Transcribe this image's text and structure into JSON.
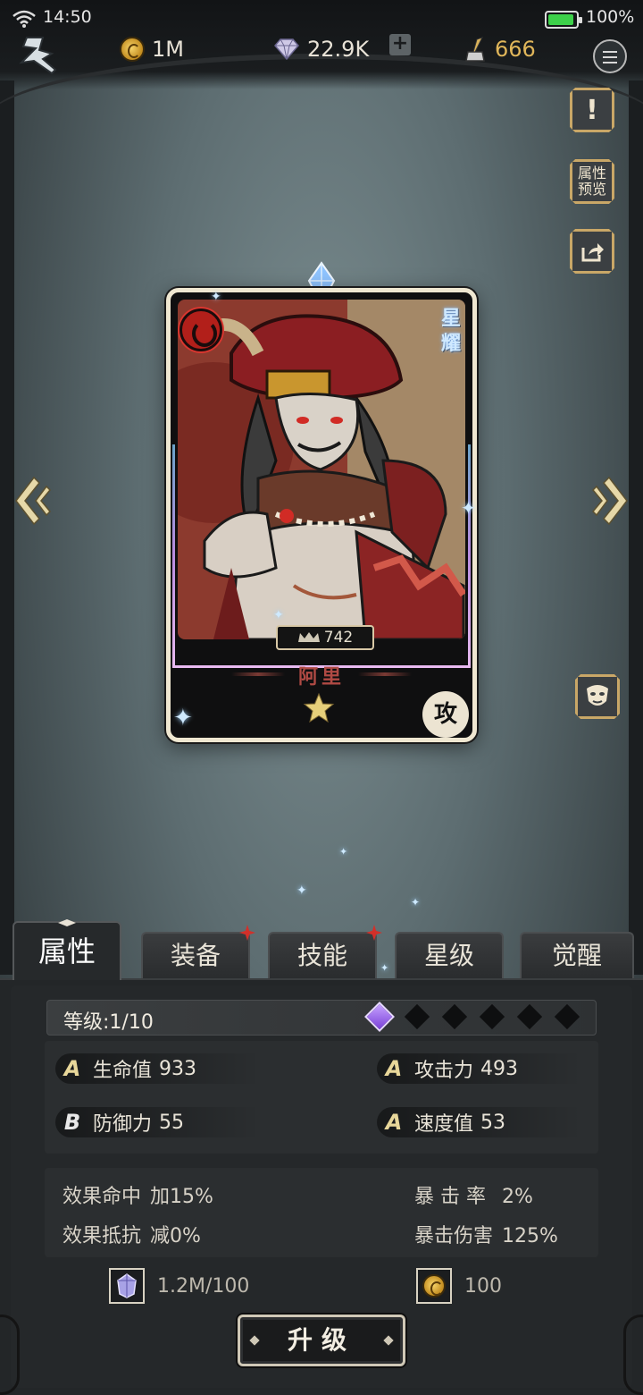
{
  "status_bar": {
    "time": "14:50",
    "battery": "100%"
  },
  "resources": {
    "gold": "1M",
    "gems": "22.9K",
    "ink": "666"
  },
  "side_buttons": {
    "info": "!",
    "preview": "属性预览"
  },
  "card": {
    "rarity": "星耀",
    "power": "742",
    "name": "阿里",
    "role": "攻",
    "stars": 1,
    "colors": {
      "element": "#b21f1a",
      "name": "#b04a44"
    }
  },
  "tabs": [
    {
      "label": "属性",
      "active": true,
      "alert": false
    },
    {
      "label": "装备",
      "active": false,
      "alert": true
    },
    {
      "label": "技能",
      "active": false,
      "alert": true
    },
    {
      "label": "星级",
      "active": false,
      "alert": false
    },
    {
      "label": "觉醒",
      "active": false,
      "alert": false
    }
  ],
  "level": {
    "text": "等级:1/10",
    "pips_filled": 1,
    "pips_total": 6
  },
  "stats": [
    {
      "grade": "A",
      "name": "生命值",
      "value": "933"
    },
    {
      "grade": "A",
      "name": "攻击力",
      "value": "493"
    },
    {
      "grade": "B",
      "name": "防御力",
      "value": "55"
    },
    {
      "grade": "A",
      "name": "速度值",
      "value": "53"
    }
  ],
  "effects": [
    {
      "name": "效果命中",
      "value": "加15%"
    },
    {
      "name": "暴 击 率",
      "value": "2%"
    },
    {
      "name": "效果抵抗",
      "value": "减0%"
    },
    {
      "name": "暴击伤害",
      "value": "125%"
    }
  ],
  "costs": {
    "crystal": "1.2M/100",
    "gold": "100"
  },
  "upgrade_label": "升级"
}
